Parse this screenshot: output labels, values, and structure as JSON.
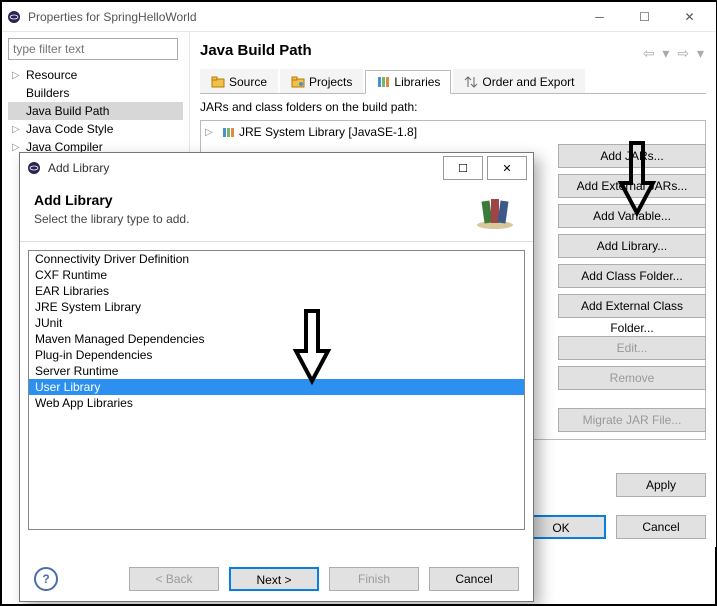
{
  "propsWindow": {
    "title": "Properties for SpringHelloWorld",
    "filterPlaceholder": "type filter text",
    "tree": {
      "resource": "Resource",
      "builders": "Builders",
      "javaBuildPath": "Java Build Path",
      "javaCodeStyle": "Java Code Style",
      "javaCompiler": "Java Compiler"
    },
    "heading": "Java Build Path",
    "tabs": {
      "source": "Source",
      "projects": "Projects",
      "libraries": "Libraries",
      "order": "Order and Export"
    },
    "jarDesc": "JARs and class folders on the build path:",
    "jreItem": "JRE System Library [JavaSE-1.8]",
    "buttons": {
      "addJars": "Add JARs...",
      "addExtJars": "Add External JARs...",
      "addVariable": "Add Variable...",
      "addLibrary": "Add Library...",
      "addClassFolder": "Add Class Folder...",
      "addExtClassFolder": "Add External Class Folder...",
      "edit": "Edit...",
      "remove": "Remove",
      "migrate": "Migrate JAR File..."
    },
    "apply": "Apply",
    "ok": "OK",
    "cancel": "Cancel"
  },
  "dialog": {
    "title": "Add Library",
    "heading": "Add Library",
    "sub": "Select the library type to add.",
    "items": {
      "cdd": "Connectivity Driver Definition",
      "cxf": "CXF Runtime",
      "ear": "EAR Libraries",
      "jre": "JRE System Library",
      "junit": "JUnit",
      "maven": "Maven Managed Dependencies",
      "plugin": "Plug-in Dependencies",
      "server": "Server Runtime",
      "user": "User Library",
      "webapp": "Web App Libraries"
    },
    "back": "< Back",
    "next": "Next >",
    "finish": "Finish",
    "cancel": "Cancel"
  }
}
